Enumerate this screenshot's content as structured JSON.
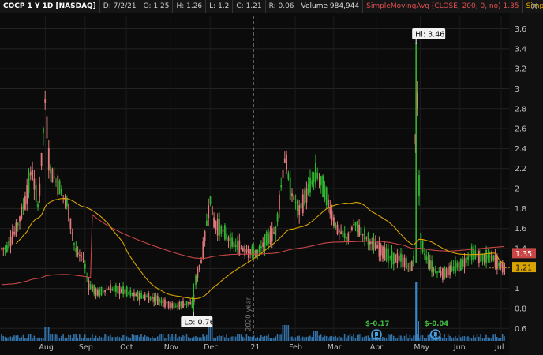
{
  "header": {
    "symbol": "COCP 1 Y 1D [NASDAQ]",
    "date": "D: 7/2/21",
    "open": "O: 1.25",
    "high": "H: 1.26",
    "low": "L: 1.2",
    "close": "C: 1.21",
    "range": "R: 0.06",
    "volume_label": "Volume",
    "volume_value": "984,944",
    "sma1": "SimpleMovingAvg (CLOSE, 200, 0, no)",
    "sma1_value": "1.35",
    "sma2": "SimpleMovingAvg"
  },
  "price_axis": {
    "ticks": [
      "3.6",
      "3.4",
      "3.2",
      "3",
      "2.8",
      "2.6",
      "2.4",
      "2.2",
      "2",
      "1.8",
      "1.6",
      "1.4",
      "1.2",
      "1",
      "0.8",
      "0.6"
    ]
  },
  "time_axis": {
    "labels": [
      "Aug",
      "Sep",
      "Oct",
      "Nov",
      "Dec",
      "21",
      "Feb",
      "Mar",
      "Apr",
      "May",
      "Jun",
      "Jul"
    ],
    "year_marker": "2020 year"
  },
  "callouts": {
    "high": "Hi: 3.46",
    "low": "Lo: 0.76"
  },
  "events": [
    {
      "label": "$-0.17"
    },
    {
      "label": "$-0.04"
    }
  ],
  "price_tags": {
    "sma": "1.35",
    "last": "1.21"
  },
  "colors": {
    "up": "#2fb52f",
    "down": "#e07a7a",
    "sma200": "#c84646",
    "sma50": "#d8a400",
    "volume": "#3a86c8",
    "grid": "#232323",
    "event": "#4aa0e0",
    "event_label": "#3fbf3f"
  },
  "chart_data": {
    "type": "line",
    "ylim": [
      0.5,
      3.7
    ],
    "series": [],
    "anchors": [
      [
        "2020-07-06",
        1.4
      ],
      [
        "2020-07-13",
        1.6
      ],
      [
        "2020-07-20",
        1.9
      ],
      [
        "2020-07-24",
        2.2
      ],
      [
        "2020-07-29",
        1.8
      ],
      [
        "2020-08-03",
        2.9
      ],
      [
        "2020-08-06",
        2.2
      ],
      [
        "2020-08-12",
        2.05
      ],
      [
        "2020-08-19",
        1.85
      ],
      [
        "2020-08-24",
        1.45
      ],
      [
        "2020-08-26",
        1.35
      ],
      [
        "2020-08-31",
        1.3
      ],
      [
        "2020-09-03",
        1.05
      ],
      [
        "2020-09-10",
        0.95
      ],
      [
        "2020-09-18",
        1.0
      ],
      [
        "2020-09-28",
        0.98
      ],
      [
        "2020-10-08",
        0.93
      ],
      [
        "2020-10-22",
        0.9
      ],
      [
        "2020-11-05",
        0.82
      ],
      [
        "2020-11-16",
        0.86
      ],
      [
        "2020-11-19",
        0.82
      ],
      [
        "2020-11-20",
        1.05
      ],
      [
        "2020-11-25",
        1.3
      ],
      [
        "2020-12-01",
        1.9
      ],
      [
        "2020-12-04",
        1.65
      ],
      [
        "2020-12-10",
        1.58
      ],
      [
        "2020-12-17",
        1.45
      ],
      [
        "2020-12-24",
        1.4
      ],
      [
        "2021-01-04",
        1.35
      ],
      [
        "2021-01-11",
        1.48
      ],
      [
        "2021-01-18",
        1.58
      ],
      [
        "2021-01-21",
        1.95
      ],
      [
        "2021-01-25",
        2.35
      ],
      [
        "2021-01-28",
        2.0
      ],
      [
        "2021-02-04",
        1.78
      ],
      [
        "2021-02-11",
        2.0
      ],
      [
        "2021-02-16",
        2.15
      ],
      [
        "2021-02-19",
        2.1
      ],
      [
        "2021-02-24",
        1.9
      ],
      [
        "2021-03-01",
        1.68
      ],
      [
        "2021-03-04",
        1.58
      ],
      [
        "2021-03-11",
        1.5
      ],
      [
        "2021-03-16",
        1.65
      ],
      [
        "2021-03-22",
        1.55
      ],
      [
        "2021-03-29",
        1.45
      ],
      [
        "2021-04-05",
        1.38
      ],
      [
        "2021-04-12",
        1.3
      ],
      [
        "2021-04-19",
        1.3
      ],
      [
        "2021-04-26",
        1.2
      ],
      [
        "2021-04-29",
        1.3
      ],
      [
        "2021-04-30",
        3.46
      ],
      [
        "2021-05-03",
        1.5
      ],
      [
        "2021-05-06",
        1.35
      ],
      [
        "2021-05-13",
        1.18
      ],
      [
        "2021-05-20",
        1.15
      ],
      [
        "2021-05-27",
        1.2
      ],
      [
        "2021-06-03",
        1.25
      ],
      [
        "2021-06-10",
        1.35
      ],
      [
        "2021-06-17",
        1.3
      ],
      [
        "2021-06-24",
        1.32
      ],
      [
        "2021-07-02",
        1.21
      ]
    ]
  }
}
